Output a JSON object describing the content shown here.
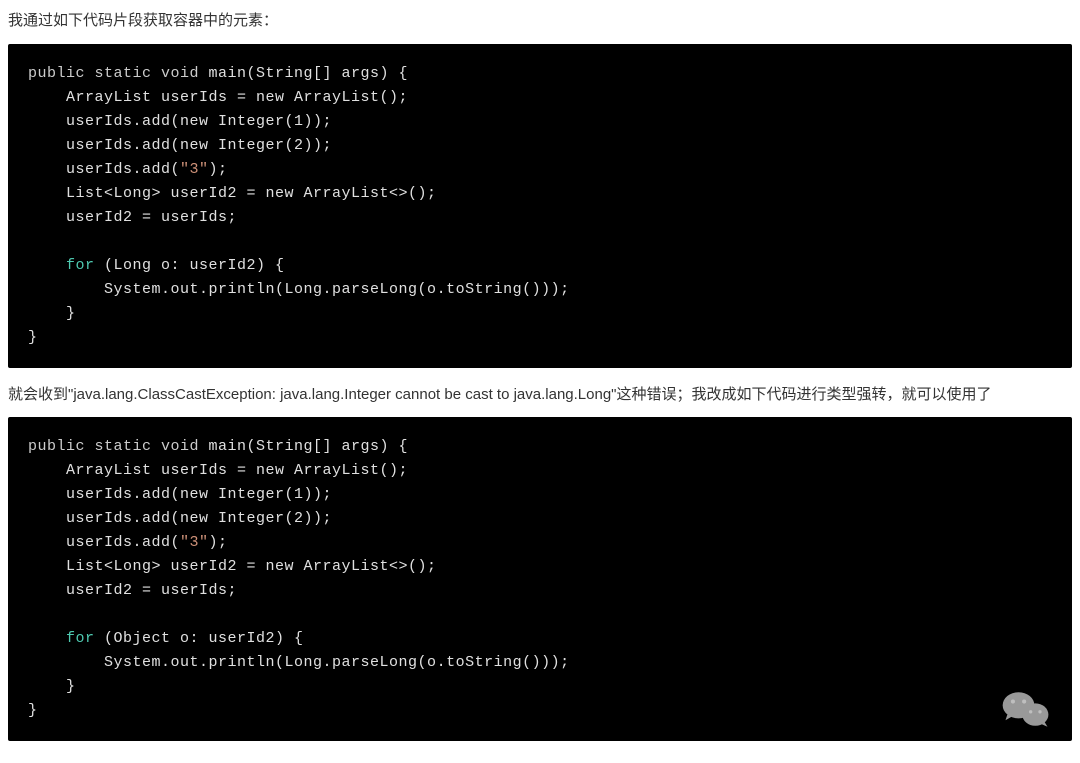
{
  "paragraph1": "我通过如下代码片段获取容器中的元素：",
  "code1": {
    "line1_a": "public static void",
    "line1_b": " main(String[] args) {",
    "line2": "    ArrayList userIds = new ArrayList();",
    "line3": "    userIds.add(new Integer(1));",
    "line4": "    userIds.add(new Integer(2));",
    "line5_a": "    userIds.add(",
    "line5_b": "\"3\"",
    "line5_c": ");",
    "line6": "    List<Long> userId2 = new ArrayList<>();",
    "line7": "    userId2 = userIds;",
    "line8": "",
    "line9_a": "    ",
    "line9_b": "for",
    "line9_c": " (Long o: userId2) {",
    "line10": "        System.out.println(Long.parseLong(o.toString()));",
    "line11": "    }",
    "line12": "}"
  },
  "paragraph2": "就会收到\"java.lang.ClassCastException: java.lang.Integer cannot be cast to java.lang.Long\"这种错误；我改成如下代码进行类型强转，就可以使用了",
  "code2": {
    "line1_a": "public static void",
    "line1_b": " main(String[] args) {",
    "line2": "    ArrayList userIds = new ArrayList();",
    "line3": "    userIds.add(new Integer(1));",
    "line4": "    userIds.add(new Integer(2));",
    "line5_a": "    userIds.add(",
    "line5_b": "\"3\"",
    "line5_c": ");",
    "line6": "    List<Long> userId2 = new ArrayList<>();",
    "line7": "    userId2 = userIds;",
    "line8": "",
    "line9_a": "    ",
    "line9_b": "for",
    "line9_c": " (Object o: userId2) {",
    "line10": "        System.out.println(Long.parseLong(o.toString()));",
    "line11": "    }",
    "line12": "}"
  },
  "icon_name": "wechat-icon"
}
